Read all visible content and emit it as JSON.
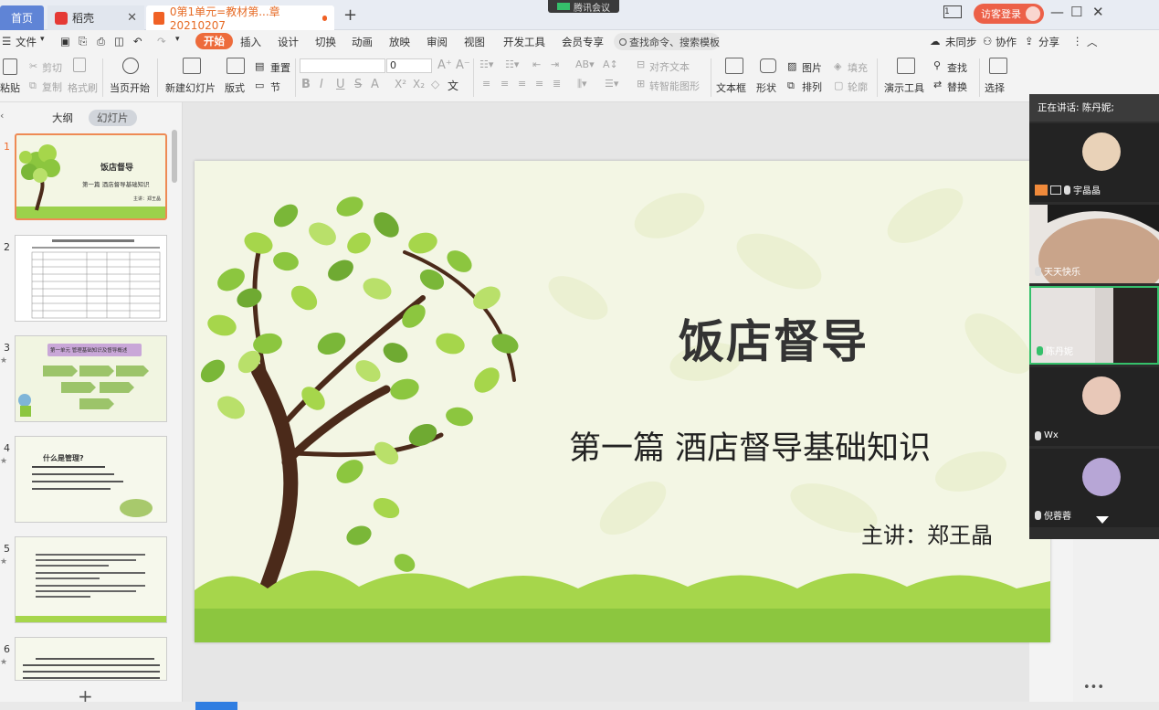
{
  "titlebar": {
    "tabs": [
      {
        "label": "首页"
      },
      {
        "label": "稻壳"
      },
      {
        "label": "0第1单元=教材第...章20210207"
      }
    ],
    "meeting_badge": "腾讯会议",
    "page_indicator": "1",
    "login_label": "访客登录"
  },
  "menu": {
    "file": "文件",
    "items": [
      "开始",
      "插入",
      "设计",
      "切换",
      "动画",
      "放映",
      "审阅",
      "视图",
      "开发工具",
      "会员专享"
    ],
    "search": "查找命令、搜索模板",
    "sync": "未同步",
    "collab": "协作",
    "share": "分享"
  },
  "ribbon": {
    "paste": "粘贴",
    "cut": "剪切",
    "copy": "复制",
    "format_painter": "格式刷",
    "from_current": "当页开始",
    "new_slide": "新建幻灯片",
    "layout": "版式",
    "section": "节",
    "reset": "重置",
    "font_size": "0",
    "align_text": "对齐文本",
    "smart_graphic": "转智能图形",
    "textbox": "文本框",
    "shape": "形状",
    "picture": "图片",
    "arrange": "排列",
    "fill": "填充",
    "outline": "轮廓",
    "present_tools": "演示工具",
    "find": "查找",
    "replace": "替换",
    "select": "选择"
  },
  "left_panel": {
    "tab_outline": "大纲",
    "tab_slides": "幻灯片",
    "slides": [
      {
        "num": "1",
        "title": "饭店督导",
        "sub": "第一篇  酒店督导基础知识",
        "author": "主讲：郑王晶"
      },
      {
        "num": "2",
        "title": "",
        "sub": "",
        "author": ""
      },
      {
        "num": "3",
        "title": "第一单元 管理基础知识及督导概述",
        "sub": "",
        "author": ""
      },
      {
        "num": "4",
        "title": "什么是管理?",
        "sub": "",
        "author": ""
      },
      {
        "num": "5",
        "title": "",
        "sub": "",
        "author": ""
      },
      {
        "num": "6",
        "title": "",
        "sub": "",
        "author": ""
      }
    ]
  },
  "slide": {
    "title": "饭店督导",
    "subtitle": "第一篇  酒店督导基础知识",
    "author": "主讲：郑王晶"
  },
  "meeting": {
    "speaking": "正在讲话: 陈丹妮;",
    "participants": [
      "宇晶晶",
      "天天快乐",
      "陈丹妮",
      "Wx",
      "倪蓉蓉"
    ]
  },
  "colors": {
    "accent": "#ed6b3b",
    "tab_blue": "#5f84d6",
    "slide_bg": "#f3f6e4",
    "leaf_green": "#8cc63f",
    "grass_green": "#9bd14b",
    "trunk": "#4b2a1a"
  }
}
